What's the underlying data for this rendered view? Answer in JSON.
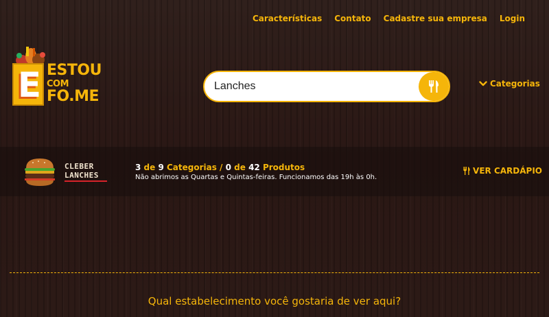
{
  "nav": {
    "items": [
      "Características",
      "Contato",
      "Cadastre sua empresa",
      "Login"
    ]
  },
  "logo": {
    "letter": "E",
    "line1": "ESTOU",
    "line2": "COM",
    "line3": "FO.ME"
  },
  "search": {
    "value": "Lanches",
    "icon": "fork-knife-icon"
  },
  "categories": {
    "label": "Categorias",
    "icon": "chevron-down-icon"
  },
  "store": {
    "name_line1": "CLEBER",
    "name_line2": "LANCHES",
    "categories_shown": "3",
    "categories_text_a": " de ",
    "categories_total": "9",
    "categories_text_b": " Categorias / ",
    "products_shown": "0",
    "products_text_a": " de ",
    "products_total": "42",
    "products_text_b": " Produtos",
    "notice": "Não abrimos as Quartas e Quintas-feiras. Funcionamos das 19h às 0h.",
    "menu_label": "VER CARDÁPIO",
    "menu_icon": "fork-knife-icon"
  },
  "question": "Qual estabelecimento você gostaria de ver aqui?",
  "colors": {
    "accent": "#f5b50a",
    "background": "#2a1714",
    "brand_orange": "#e05a14"
  }
}
